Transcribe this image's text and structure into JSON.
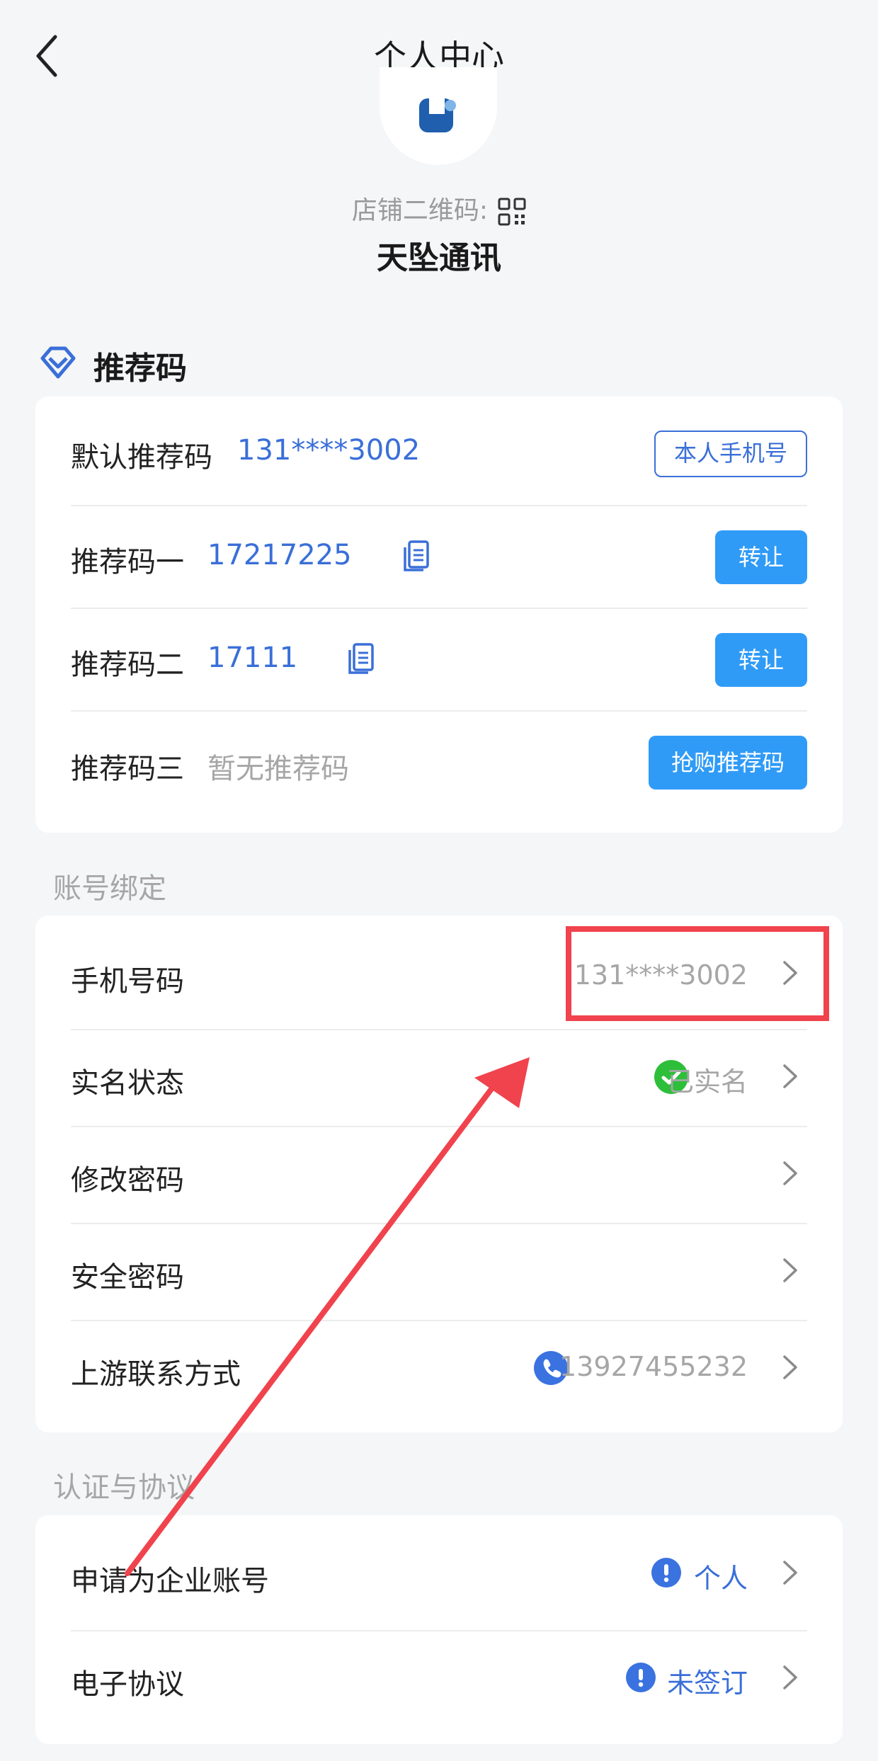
{
  "header": {
    "title": "个人中心"
  },
  "profile": {
    "qr_label": "店铺二维码:",
    "shop_name": "天坠通讯"
  },
  "referral": {
    "section_title": "推荐码",
    "rows": [
      {
        "label": "默认推荐码",
        "value": "131****3002",
        "action": "本人手机号"
      },
      {
        "label": "推荐码一",
        "value": "17217225",
        "action": "转让"
      },
      {
        "label": "推荐码二",
        "value": "17111",
        "action": "转让"
      },
      {
        "label": "推荐码三",
        "value": "暂无推荐码",
        "action": "抢购推荐码"
      }
    ]
  },
  "account_binding": {
    "caption": "账号绑定",
    "rows": [
      {
        "label": "手机号码",
        "value": "131****3002"
      },
      {
        "label": "实名状态",
        "value": "已实名"
      },
      {
        "label": "修改密码",
        "value": ""
      },
      {
        "label": "安全密码",
        "value": ""
      },
      {
        "label": "上游联系方式",
        "value": "13927455232"
      }
    ]
  },
  "certification": {
    "caption": "认证与协议",
    "rows": [
      {
        "label": "申请为企业账号",
        "value": "个人"
      },
      {
        "label": "电子协议",
        "value": "未签订"
      }
    ]
  },
  "colors": {
    "accent_blue": "#3a6fd8",
    "button_blue": "#2f9bf7",
    "verified_green": "#2dbf3a",
    "annotation_red": "#f0434d",
    "background": "#f5f6f8"
  },
  "icons": {
    "back": "chevron-left-icon",
    "qr": "qr-code-icon",
    "referral_section": "diamond-icon",
    "copy": "copy-icon",
    "row_arrow": "chevron-right-icon",
    "verified": "check-circle-icon",
    "phone": "phone-icon",
    "notice": "exclamation-circle-icon"
  }
}
